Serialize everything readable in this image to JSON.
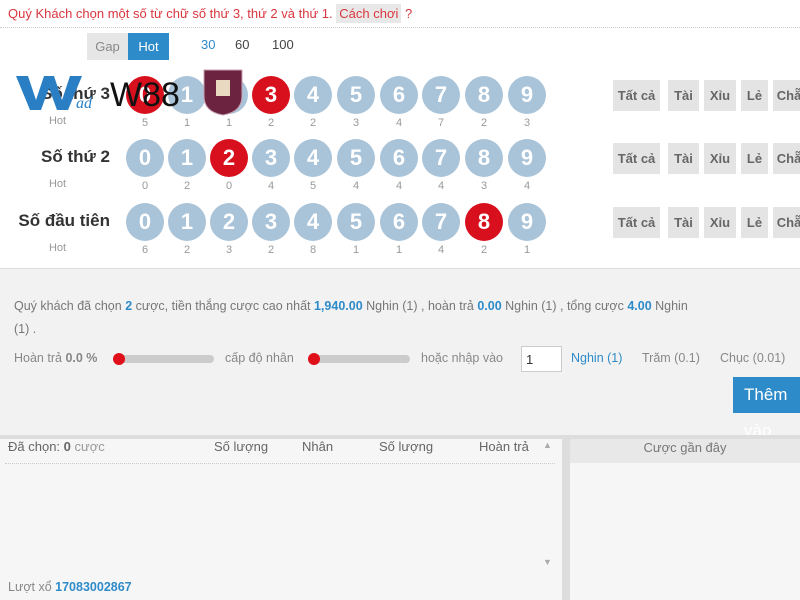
{
  "hint": {
    "text": "Quý Khách chọn một số từ chữ số thứ 3, thứ 2 và thứ 1.",
    "how_to_play": "Cách chơi",
    "question": "?"
  },
  "mode_toggle": {
    "gap": "Gap",
    "hot": "Hot",
    "active": "Hot"
  },
  "periods": {
    "items": [
      "30",
      "60",
      "100"
    ],
    "active": "30"
  },
  "hot_label": "Hot",
  "rows": [
    {
      "label": "Số thứ 3",
      "selected": [
        0,
        3
      ],
      "counts": [
        5,
        1,
        1,
        2,
        2,
        3,
        4,
        7,
        2,
        3
      ]
    },
    {
      "label": "Số thứ 2",
      "selected": [
        2
      ],
      "counts": [
        0,
        2,
        0,
        4,
        5,
        4,
        4,
        4,
        3,
        4
      ]
    },
    {
      "label": "Số đầu tiên",
      "selected": [
        8
      ],
      "counts": [
        6,
        2,
        3,
        2,
        8,
        1,
        1,
        4,
        2,
        1
      ]
    }
  ],
  "digits": [
    "0",
    "1",
    "2",
    "3",
    "4",
    "5",
    "6",
    "7",
    "8",
    "9"
  ],
  "quick_buttons": [
    "Tất cả",
    "Tài",
    "Xỉu",
    "Lẻ",
    "Chẵn"
  ],
  "logo": {
    "text": "W88"
  },
  "summary": {
    "p1": "Quý khách đã chọn ",
    "bets": "2",
    "p2": " cược, tiền thắng cược cao nhất ",
    "max_win": "1,940.00",
    "p3": " Nghin (1) , hoàn trả ",
    "rebate": "0.00",
    "p4": " Nghin (1) , tổng cược ",
    "total": "4.00",
    "p5": " Nghin",
    "line2": "(1) ."
  },
  "controls": {
    "rebate_label": "Hoàn trả",
    "rebate_value": "0.0 %",
    "multiplier_label": "cấp độ nhân",
    "input_label": "hoặc nhập vào",
    "input_value": "1",
    "units": [
      "Nghin (1)",
      "Trăm (0.1)",
      "Chục (0.01)"
    ],
    "active_unit": "Nghin (1)",
    "add_button": "Thêm vào"
  },
  "selected_table": {
    "chosen_label": "Đã chọn:",
    "chosen_count": "0",
    "chosen_unit": "cược",
    "columns": [
      "Số lượng",
      "Nhân",
      "Số lượng",
      "Hoàn trả"
    ]
  },
  "recent": {
    "title": "Cược gần đây"
  },
  "draw": {
    "label": "Lượt xổ",
    "number": "17083002867"
  },
  "colors": {
    "accent": "#2e8bc9",
    "selected": "#d8101e",
    "ball": "#a9c3d9",
    "hint": "#d9363e"
  }
}
